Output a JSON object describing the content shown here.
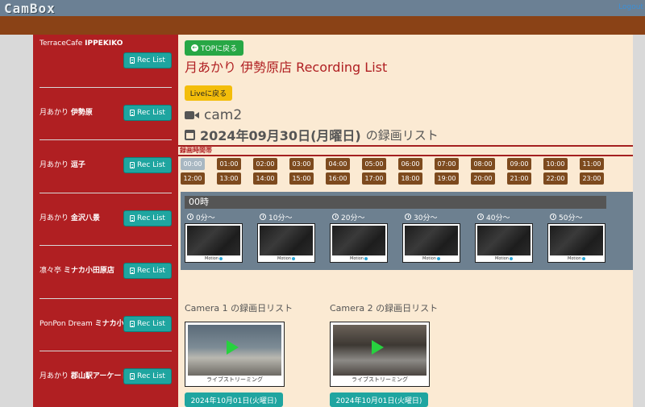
{
  "header": {
    "logo": "CamBox",
    "link": "Logout"
  },
  "sidebar": {
    "button_label": "Rec List",
    "items": [
      {
        "prefix": "TerraceCafe",
        "name": "IPPEKIKO"
      },
      {
        "prefix": "月あかり",
        "name": "伊勢原"
      },
      {
        "prefix": "月あかり",
        "name": "逗子"
      },
      {
        "prefix": "月あかり",
        "name": "金沢八景"
      },
      {
        "prefix": "凛々亭",
        "name": "ミナカ小田原店"
      },
      {
        "prefix": "PonPon Dream",
        "name": "ミナカ小田原店"
      },
      {
        "prefix": "月あかり",
        "name": "郡山駅アーケード前店"
      }
    ]
  },
  "main": {
    "top_button": "TOPに戻る",
    "title": "月あかり 伊勢原店 Recording List",
    "live_button": "Liveに戻る",
    "camera_name": "cam2",
    "date": "2024年09月30日(月曜日)",
    "date_suffix": "の録画リスト",
    "section_label": "録画時間帯",
    "hours": [
      "00:00",
      "01:00",
      "02:00",
      "03:00",
      "04:00",
      "05:00",
      "06:00",
      "07:00",
      "08:00",
      "09:00",
      "10:00",
      "11:00",
      "12:00",
      "13:00",
      "14:00",
      "15:00",
      "16:00",
      "17:00",
      "18:00",
      "19:00",
      "20:00",
      "21:00",
      "22:00",
      "23:00"
    ],
    "active_hour": "00:00",
    "hour_panel": {
      "title": "00時",
      "slots": [
        {
          "label": "0分〜",
          "caption": "Motion"
        },
        {
          "label": "10分〜",
          "caption": "Motion"
        },
        {
          "label": "20分〜",
          "caption": "Motion"
        },
        {
          "label": "30分〜",
          "caption": "Motion"
        },
        {
          "label": "40分〜",
          "caption": "Motion"
        },
        {
          "label": "50分〜",
          "caption": "Motion"
        }
      ]
    },
    "camera_lists": [
      {
        "title": "Camera 1 の録画日リスト",
        "caption": "ライブストリーミング",
        "date": "2024年10月01日(火曜日)"
      },
      {
        "title": "Camera 2 の録画日リスト",
        "caption": "ライブストリーミング",
        "date": "2024年10月01日(火曜日)"
      }
    ]
  }
}
